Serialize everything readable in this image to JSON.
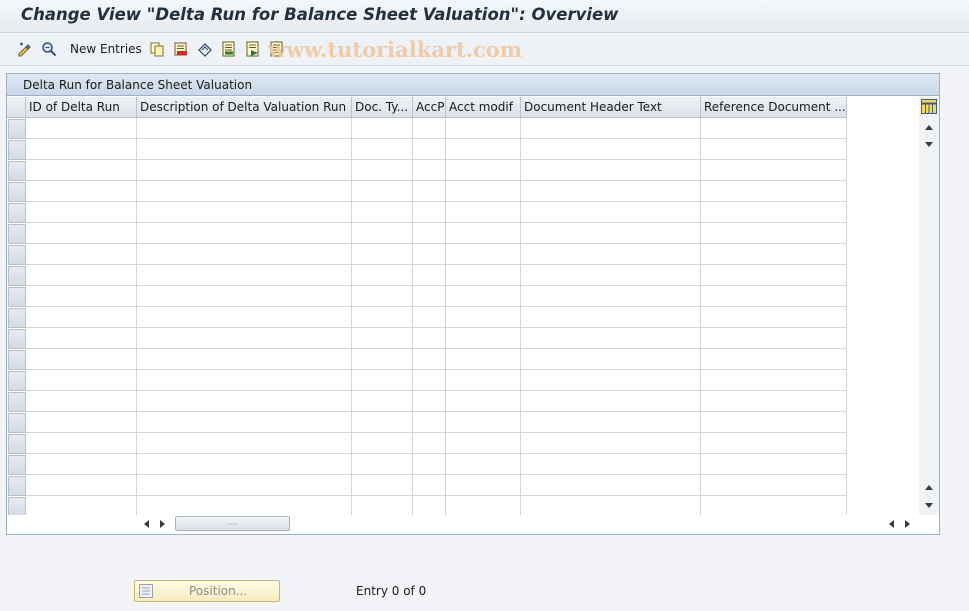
{
  "window": {
    "title": "Change View \"Delta Run for Balance Sheet Valuation\": Overview"
  },
  "toolbar": {
    "new_entries_label": "New Entries",
    "icons": [
      "display-change-icon",
      "details-icon",
      "new-entries",
      "copy-icon",
      "delete-icon",
      "undo-change-icon",
      "select-all-icon",
      "select-block-icon",
      "deselect-all-icon"
    ]
  },
  "watermark": {
    "text": "www.tutorialkart.com"
  },
  "table": {
    "caption": "Delta Run for Balance Sheet Valuation",
    "columns": [
      "ID of Delta Run",
      "Description of Delta Valuation Run",
      "Doc. Ty...",
      "AccP",
      "Acct modif",
      "Document Header Text",
      "Reference Document ..."
    ],
    "row_count": 19,
    "rows": []
  },
  "footer": {
    "position_button_label": "Position...",
    "entry_status": "Entry 0 of 0"
  },
  "colors": {
    "title_text": "#23303f",
    "panel_border": "#9fb1c4",
    "caption_bg": "#c9d8e7",
    "position_button_bg": "#f7ecc0",
    "watermark": "#f1c9a3"
  }
}
